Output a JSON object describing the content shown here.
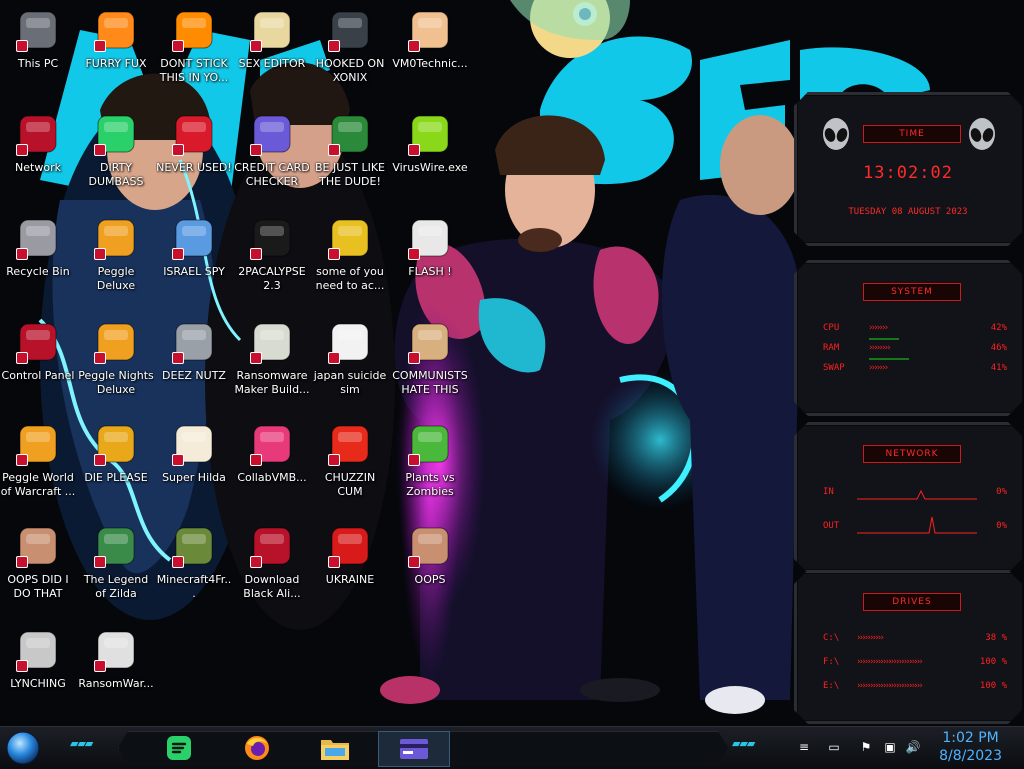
{
  "desktop": {
    "icons": [
      {
        "label": "This PC",
        "icon": "computer-icon"
      },
      {
        "label": "FURRY FUX",
        "icon": "firefox-icon"
      },
      {
        "label": "DONT STICK THIS IN YO...",
        "icon": "vlc-cone-icon"
      },
      {
        "label": "SEX EDITOR",
        "icon": "hex-editor-icon"
      },
      {
        "label": "HOOKED ON XONIX",
        "icon": "xonix-game-icon"
      },
      {
        "label": "VM0Technic...",
        "icon": "technician-icon"
      },
      {
        "label": "Network",
        "icon": "alien-network-icon"
      },
      {
        "label": "DIRTY DUMBASS",
        "icon": "spotify-like-icon"
      },
      {
        "label": "NEVER USED!",
        "icon": "dev-plus-icon"
      },
      {
        "label": "CREDIT CARD CHECKER",
        "icon": "credit-card-icon"
      },
      {
        "label": "BE JUST LIKE THE DUDE!",
        "icon": "santa-icon"
      },
      {
        "label": "VirusWire.exe",
        "icon": "lime-icon"
      },
      {
        "label": "Recycle Bin",
        "icon": "recycle-bin-icon"
      },
      {
        "label": "Peggle Deluxe",
        "icon": "peggle-icon"
      },
      {
        "label": "ISRAEL SPY",
        "icon": "spy-icon"
      },
      {
        "label": "2PACALYPSE 2.3",
        "icon": "terminal-icon"
      },
      {
        "label": "some of you need to ac...",
        "icon": "bear-icon"
      },
      {
        "label": "FLASH !",
        "icon": "flash-icon"
      },
      {
        "label": "Control Panel",
        "icon": "control-panel-icon"
      },
      {
        "label": "Peggle Nights Deluxe",
        "icon": "peggle-icon"
      },
      {
        "label": "DEEZ NUTZ",
        "icon": "windows-stack-icon"
      },
      {
        "label": "Ransomware Maker Build...",
        "icon": "ransomware-builder-icon"
      },
      {
        "label": "japan suicide sim",
        "icon": "document-icon"
      },
      {
        "label": "COMMUNISTS HATE THIS G...",
        "icon": "money-bag-icon"
      },
      {
        "label": "Peggle World of Warcraft ...",
        "icon": "peggle-icon"
      },
      {
        "label": "DIE PLEASE",
        "icon": "die-icon"
      },
      {
        "label": "Super Hilda",
        "icon": "pixel-art-icon"
      },
      {
        "label": "CollabVMB...",
        "icon": "collabvm-icon"
      },
      {
        "label": "CHUZZIN CUM",
        "icon": "chuzzle-icon"
      },
      {
        "label": "Plants vs Zombies",
        "icon": "plant-icon"
      },
      {
        "label": "OOPS DID I DO THAT",
        "icon": "portrait-icon"
      },
      {
        "label": "The Legend of Zilda",
        "icon": "zilda-icon"
      },
      {
        "label": "Minecraft4Fr...",
        "icon": "minecraft-icon"
      },
      {
        "label": "Download Black Ali...",
        "icon": "alien-network-icon"
      },
      {
        "label": "UKRAINE",
        "icon": "radiation-icon"
      },
      {
        "label": "OOPS",
        "icon": "portrait-icon"
      },
      {
        "label": "LYNCHING",
        "icon": "rope-icon"
      },
      {
        "label": "RansomWar...",
        "icon": "skull-icon"
      }
    ]
  },
  "widget": {
    "time": {
      "title": "TIME",
      "clock": "13:02:02",
      "date": "TUESDAY 08 AUGUST 2023"
    },
    "system": {
      "title": "SYSTEM",
      "rows": [
        {
          "label": "CPU",
          "value": "42%",
          "level": 42
        },
        {
          "label": "RAM",
          "value": "46%",
          "level": 46
        },
        {
          "label": "SWAP",
          "value": "41%",
          "level": 41
        }
      ]
    },
    "network": {
      "title": "NETWORK",
      "rows": [
        {
          "label": "IN",
          "value": "0%"
        },
        {
          "label": "OUT",
          "value": "0%"
        }
      ]
    },
    "drives": {
      "title": "DRIVES",
      "rows": [
        {
          "label": "C:\\",
          "value": "38 %",
          "level": 38
        },
        {
          "label": "F:\\",
          "value": "100 %",
          "level": 100
        },
        {
          "label": "E:\\",
          "value": "100 %",
          "level": 100
        }
      ]
    }
  },
  "taskbar": {
    "start_icon": "start-orb-icon",
    "pinned": [
      {
        "name": "spotify-like-taskbar-icon"
      },
      {
        "name": "firefox-taskbar-icon"
      },
      {
        "name": "file-explorer-taskbar-icon"
      },
      {
        "name": "credit-card-checker-taskbar-icon"
      }
    ],
    "clock": {
      "time": "1:02 PM",
      "date": "8/8/2023"
    }
  },
  "colors": {
    "accent_red": "#ff2020",
    "clock_blue": "#4fb3ff",
    "wallpaper_cyan": "#12c8e8",
    "wallpaper_magenta": "#e0157a"
  }
}
